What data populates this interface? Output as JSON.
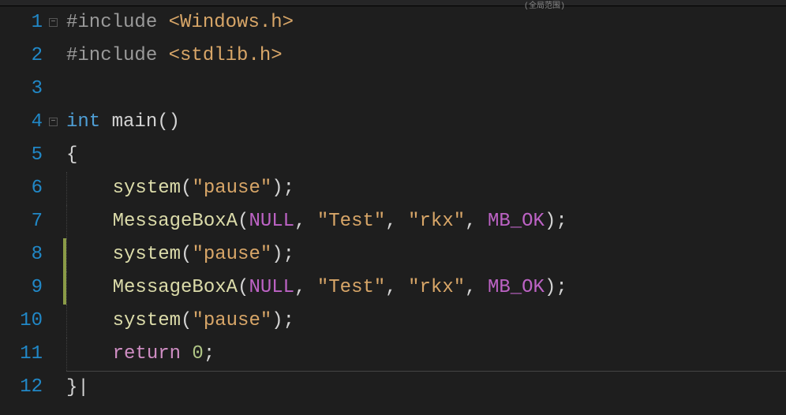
{
  "top_label": "(全局范围)",
  "lines": {
    "l1": "1",
    "l2": "2",
    "l3": "3",
    "l4": "4",
    "l5": "5",
    "l6": "6",
    "l7": "7",
    "l8": "8",
    "l9": "9",
    "l10": "10",
    "l11": "11",
    "l12": "12"
  },
  "code": {
    "include": "#include ",
    "hdr1": "<Windows.h>",
    "hdr2": "<stdlib.h>",
    "int": "int",
    "main": " main",
    "parens": "()",
    "obrace": "{",
    "cbrace": "}",
    "system": "system",
    "lparen": "(",
    "rparen": ")",
    "pause": "\"pause\"",
    "semi": ";",
    "msgbox": "MessageBoxA",
    "null": "NULL",
    "comma": ", ",
    "test": "\"Test\"",
    "rkx": "\"rkx\"",
    "mbok": "MB_OK",
    "return": "return",
    "zero": " 0",
    "pipe": "|"
  },
  "fold": {
    "minus": "−"
  }
}
